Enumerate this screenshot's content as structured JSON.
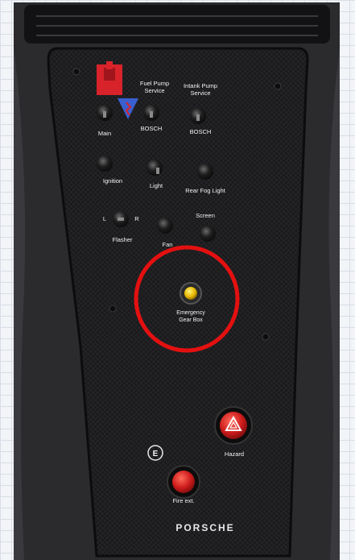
{
  "labels": {
    "fuel_pump_line1": "Fuel Pump",
    "fuel_pump_line2": "Service",
    "intank_pump_line1": "Intank Pump",
    "intank_pump_line2": "Service",
    "bosch_left": "BOSCH",
    "bosch_right": "BOSCH",
    "main": "Main",
    "ignition": "Ignition",
    "light": "Light",
    "rear_fog_light": "Rear Fog Light",
    "flasher_left": "L",
    "flasher_right": "R",
    "flasher": "Flasher",
    "fan": "Fan",
    "screen": "Screen",
    "emergency_line1": "Emergency",
    "emergency_line2": "Gear Box",
    "hazard": "Hazard",
    "e_badge": "E",
    "fire_ext": "Fire ext.",
    "brand": "PORSCHE"
  },
  "colors": {
    "panel": "#1c1c1e",
    "interior": "#2b2b2e",
    "highlight_circle": "#e41010",
    "hazard_button": "#cc1b1b",
    "emergency_button": "#e8b800",
    "main_switch": "#d8232a",
    "warning_triangle": "#3a5fcf"
  },
  "icons": [
    "warning-triangle-icon",
    "hazard-triangle-icon",
    "main-switch-icon"
  ]
}
